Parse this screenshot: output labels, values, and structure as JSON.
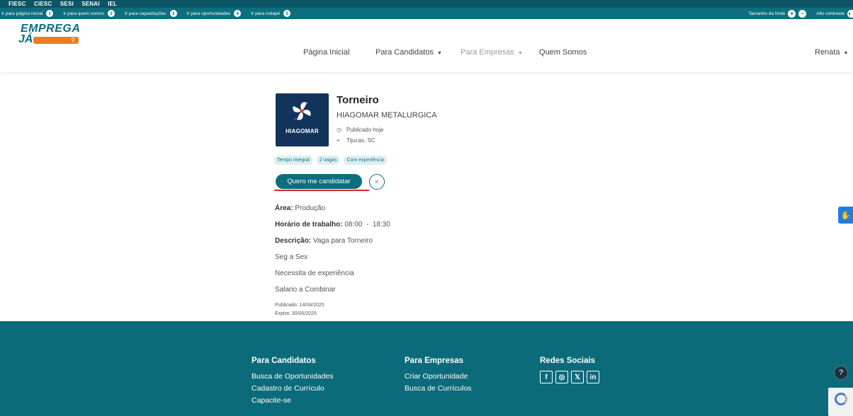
{
  "institutional_bar": {
    "brands": [
      "FIESC",
      "CIESC",
      "SESI",
      "SENAI",
      "IEL"
    ]
  },
  "accessibility_bar": {
    "skip_links": [
      {
        "label": "Ir para página inicial",
        "number": "1"
      },
      {
        "label": "Ir para quem somos",
        "number": "2"
      },
      {
        "label": "Ir para capacitações",
        "number": "3"
      },
      {
        "label": "Ir para oportunidades",
        "number": "4"
      },
      {
        "label": "Ir para rodapé",
        "number": "5"
      }
    ],
    "font_size_label": "Tamanho da fonte",
    "font_increase": "+",
    "font_decrease": "-",
    "contrast_label": "Alto contraste"
  },
  "header": {
    "logo_line1": "EMPREGA",
    "logo_line2": "JÁ",
    "nav": {
      "home": "Página Inicial",
      "candidates": "Para Candidatos",
      "companies": "Para Empresas",
      "about": "Quem Somos"
    },
    "user_name": "Renata"
  },
  "job": {
    "company_logo_text": "HIAGOMAR",
    "title": "Torneiro",
    "company": "HIAGOMAR METALURGICA",
    "published_label": "Publicado hoje",
    "location": "Tijucas, SC",
    "tags": [
      "Tempo integral",
      "2 vagas",
      "Com experiência"
    ],
    "apply_label": "Quero me candidatar",
    "area_label": "Área:",
    "area_value": "Produção",
    "hours_label": "Horário de trabalho:",
    "hours_value": "08:00  -  18:30",
    "description_label": "Descrição:",
    "description_value": "Vaga para Torneiro",
    "description_lines": [
      "Seg a Sex",
      "Necessita de experiência",
      "Salario a Combinar"
    ],
    "published_date": "Publicado: 14/04/2025",
    "expires_date": "Expira: 30/06/2025"
  },
  "footer": {
    "candidates_title": "Para Candidatos",
    "candidates_links": [
      "Busca de Oportunidades",
      "Cadastro de Currículo",
      "Capacite-se"
    ],
    "companies_title": "Para Empresas",
    "companies_links": [
      "Criar Oportunidade",
      "Busca de Currículos"
    ],
    "social_title": "Redes Sociais",
    "social_icons": [
      "facebook-icon",
      "instagram-icon",
      "x-icon",
      "linkedin-icon"
    ]
  },
  "colors": {
    "primary": "#0d6e7d",
    "accent": "#f07d1a",
    "highlight": "#e02222",
    "footer_bg": "#0c6b7a"
  }
}
